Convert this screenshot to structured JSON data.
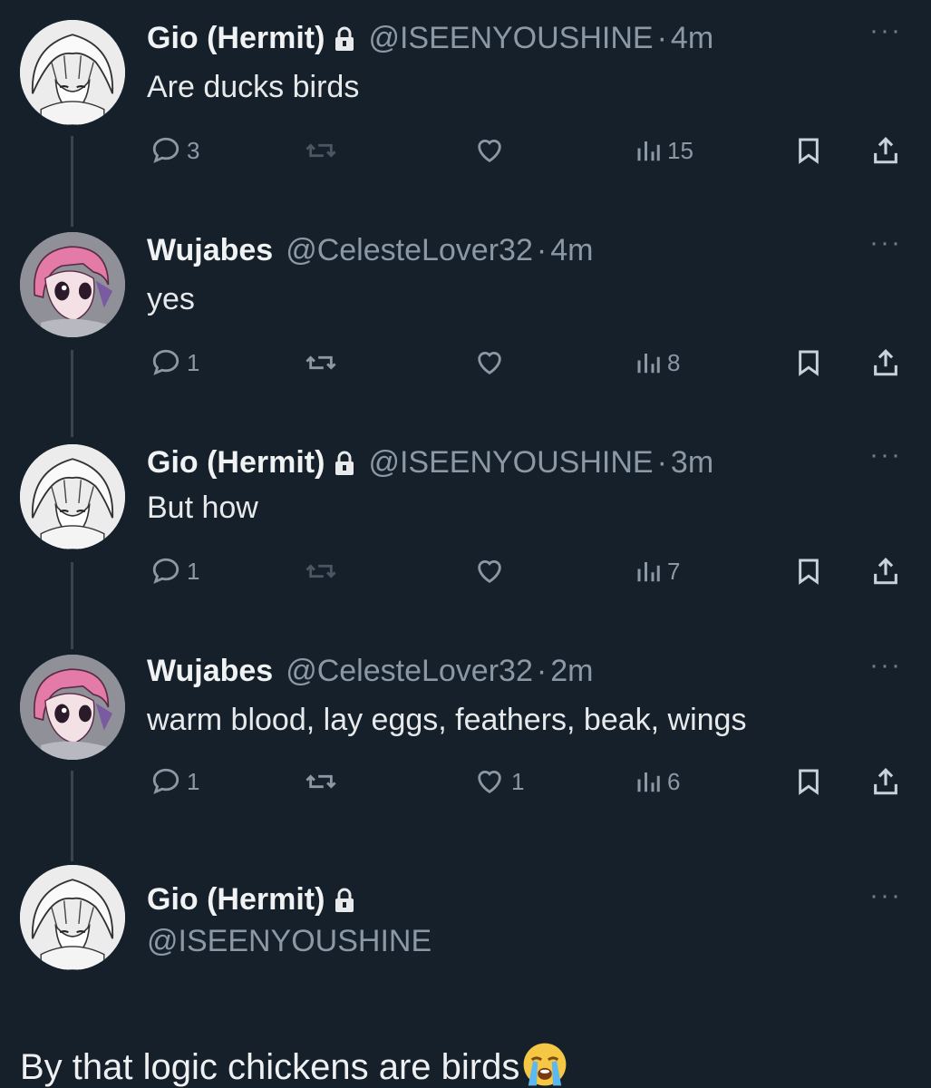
{
  "thread": [
    {
      "name": "Gio (Hermit)",
      "locked": true,
      "handle": "@ISEENYOUSHINE",
      "separator": "·",
      "time": "4m",
      "text": "Are ducks birds",
      "actions": {
        "replies": "3",
        "reposts": "",
        "likes": "",
        "views": "15"
      },
      "avatar": "grayscale-anime-avatar"
    },
    {
      "name": "Wujabes",
      "locked": false,
      "handle": "@CelesteLover32",
      "separator": "·",
      "time": "4m",
      "text": "yes",
      "actions": {
        "replies": "1",
        "reposts": "",
        "likes": "",
        "views": "8"
      },
      "avatar": "pink-hair-anime-avatar"
    },
    {
      "name": "Gio (Hermit)",
      "locked": true,
      "handle": "@ISEENYOUSHINE",
      "separator": "·",
      "time": "3m",
      "text": "But how",
      "actions": {
        "replies": "1",
        "reposts": "",
        "likes": "",
        "views": "7"
      },
      "avatar": "grayscale-anime-avatar"
    },
    {
      "name": "Wujabes",
      "locked": false,
      "handle": "@CelesteLover32",
      "separator": "·",
      "time": "2m",
      "text": "warm blood, lay eggs, feathers, beak, wings",
      "actions": {
        "replies": "1",
        "reposts": "",
        "likes": "1",
        "views": "6"
      },
      "avatar": "pink-hair-anime-avatar"
    }
  ],
  "main_post": {
    "name": "Gio (Hermit)",
    "locked": true,
    "handle": "@ISEENYOUSHINE",
    "text": "By that logic chickens are birds",
    "emoji": "loudly-crying-face-emoji",
    "avatar": "grayscale-anime-avatar"
  },
  "more_label": "···",
  "colors": {
    "background": "#15202b",
    "text": "#e7e9ea",
    "secondary": "#8b98a5",
    "thread_line": "#3a4450"
  }
}
